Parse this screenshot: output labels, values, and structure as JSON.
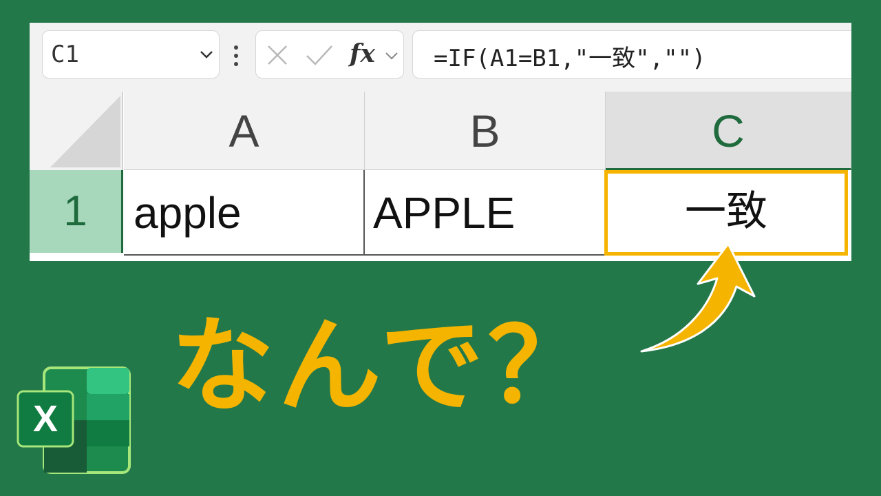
{
  "formula_bar": {
    "name_box": "C1",
    "fx_label": "fx",
    "formula": "=IF(A1=B1,\"一致\",\"\")"
  },
  "columns": [
    "A",
    "B",
    "C"
  ],
  "rows": [
    {
      "header": "1",
      "cells": [
        "apple",
        "APPLE",
        "一致"
      ]
    }
  ],
  "overlay": {
    "question": "なんで？"
  },
  "logo": {
    "letter": "X"
  },
  "colors": {
    "background": "#23784a",
    "accent": "#f5b400",
    "excel_green": "#1f6b3d"
  }
}
